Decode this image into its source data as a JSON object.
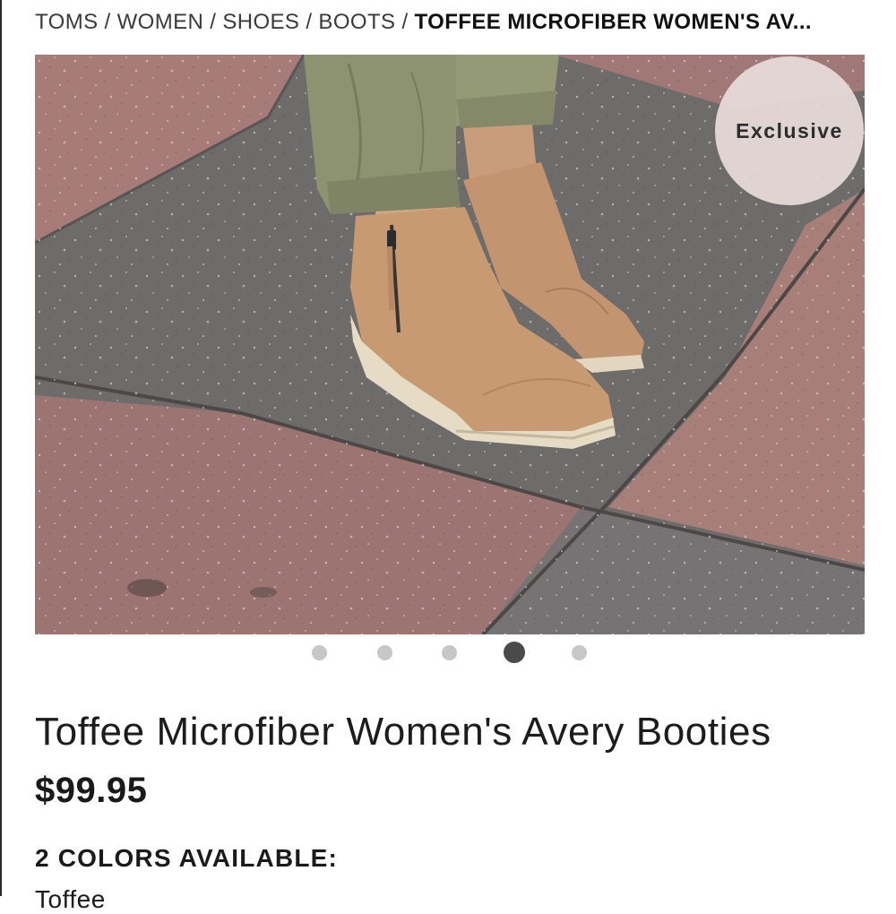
{
  "breadcrumb": {
    "items": [
      "TOMS",
      "WOMEN",
      "SHOES",
      "BOOTS"
    ],
    "current": "TOFFEE MICROFIBER WOMEN'S AV...",
    "separator": "/"
  },
  "hero": {
    "badge": "Exclusive",
    "carousel_count": 5,
    "carousel_active_index": 4
  },
  "product": {
    "title": "Toffee Microfiber Women's Avery Booties",
    "price": "$99.95",
    "colors_label": "2 COLORS AVAILABLE:",
    "selected_color": "Toffee"
  },
  "colors": {
    "dot_inactive": "#c7c7c7",
    "dot_active": "#4a4a4a",
    "boot": "#c89a72",
    "pants": "#8d9270",
    "pavement_gray": "#6e6b6b",
    "pavement_red": "#a77c78"
  }
}
